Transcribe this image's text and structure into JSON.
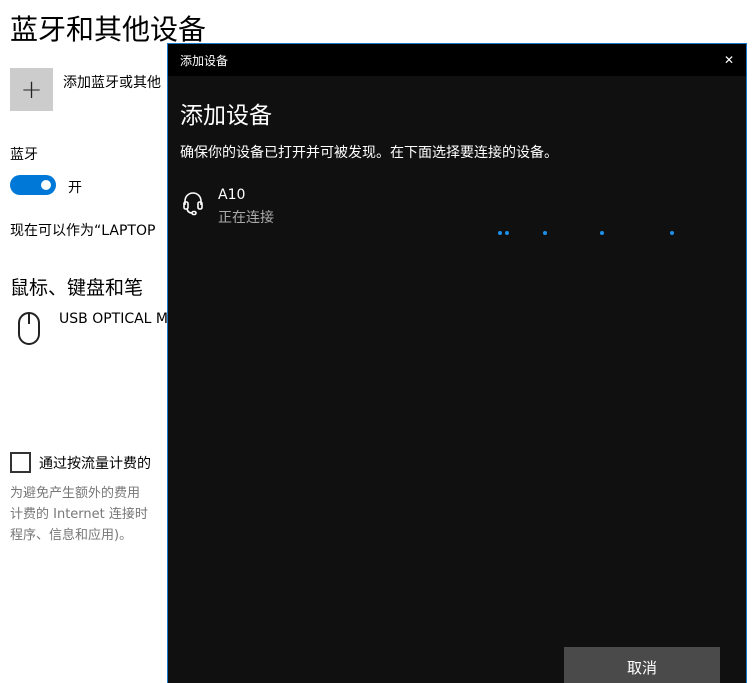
{
  "settings": {
    "title": "蓝牙和其他设备",
    "add_device_label": "添加蓝牙或其他",
    "add_icon": "+",
    "bluetooth_label": "蓝牙",
    "toggle_state": "开",
    "discoverable_text": "现在可以作为“LAPTOP",
    "mouse_section": "鼠标、键盘和笔",
    "mouse_device": "USB OPTICAL M",
    "metered_checkbox_label": "通过按流量计费的",
    "metered_desc": [
      "为避免产生额外的费用",
      "计费的 Internet 连接时",
      "程序、信息和应用)。"
    ]
  },
  "dialog": {
    "window_title": "添加设备",
    "close_icon": "✕",
    "heading": "添加设备",
    "subtitle": "确保你的设备已打开并可被发现。在下面选择要连接的设备。",
    "device": {
      "name": "A10",
      "status": "正在连接",
      "icon": "headset-icon"
    },
    "cancel_label": "取消"
  },
  "colors": {
    "accent": "#0078d7"
  }
}
